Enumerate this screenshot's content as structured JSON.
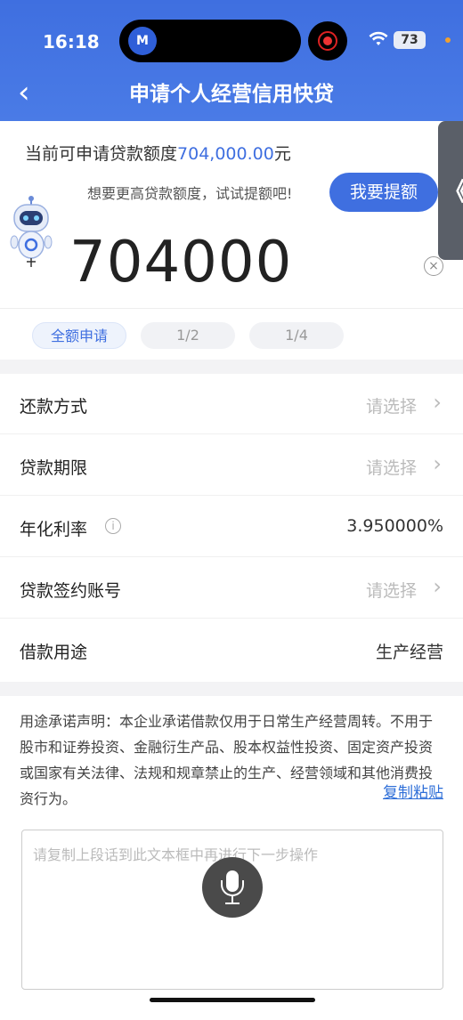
{
  "status": {
    "time": "16:18",
    "battery": "73",
    "island_app": "M"
  },
  "nav": {
    "back_icon": "‹",
    "title": "申请个人经营信用快贷"
  },
  "quota": {
    "prefix": "当前可申请贷款额度",
    "amount": "704,000.00",
    "suffix": "元",
    "hint": "想要更高贷款额度，试试提额吧!",
    "raise_button": "我要提额",
    "side_tab": "《"
  },
  "amount_input": {
    "value": "704000",
    "clear_icon": "×"
  },
  "chips": [
    "全额申请",
    "1/2",
    "1/4"
  ],
  "form": {
    "rows": [
      {
        "label": "还款方式",
        "value": "请选择"
      },
      {
        "label": "贷款期限",
        "value": "请选择"
      },
      {
        "label": "年化利率",
        "value": "3.950000%",
        "info_icon": "i"
      },
      {
        "label": "贷款签约账号",
        "value": "请选择"
      },
      {
        "label": "借款用途",
        "value": "生产经营"
      }
    ],
    "chevron": "›"
  },
  "statement": {
    "text": "用途承诺声明：本企业承诺借款仅用于日常生产经营周转。不用于股市和证券投资、金融衍生产品、股本权益性投资、固定资产投资或国家有关法律、法规和规章禁止的生产、经营领域和其他消费投资行为。",
    "copy_link": "复制粘贴",
    "placeholder": "请复制上段话到此文本框中再进行下一步操作"
  },
  "colors": {
    "primary": "#3f6fe0",
    "link": "#2f6fd8"
  }
}
